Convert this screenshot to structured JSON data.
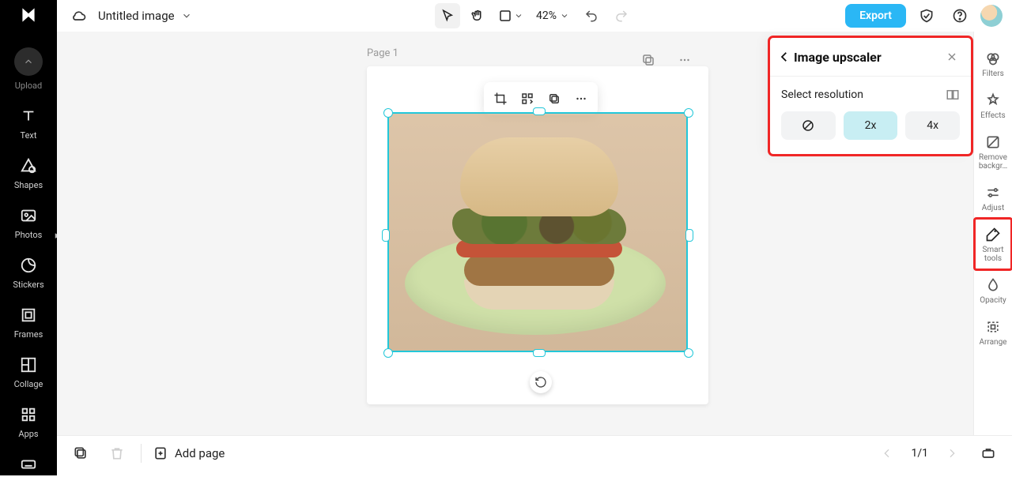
{
  "document": {
    "title": "Untitled image"
  },
  "header": {
    "zoom": "42%",
    "export_label": "Export"
  },
  "sidebar": {
    "items": [
      {
        "label": "Upload"
      },
      {
        "label": "Text"
      },
      {
        "label": "Shapes"
      },
      {
        "label": "Photos"
      },
      {
        "label": "Stickers"
      },
      {
        "label": "Frames"
      },
      {
        "label": "Collage"
      },
      {
        "label": "Apps"
      }
    ]
  },
  "right_panel": {
    "items": [
      {
        "label": "Filters"
      },
      {
        "label": "Effects"
      },
      {
        "label": "Remove backgr…"
      },
      {
        "label": "Adjust"
      },
      {
        "label": "Smart tools"
      },
      {
        "label": "Opacity"
      },
      {
        "label": "Arrange"
      }
    ]
  },
  "upscaler_panel": {
    "title": "Image upscaler",
    "select_label": "Select resolution",
    "options": {
      "none": "⦸",
      "two_x": "2x",
      "four_x": "4x"
    },
    "active": "two_x"
  },
  "canvas": {
    "page_label": "Page 1"
  },
  "footer": {
    "add_page_label": "Add page",
    "page_indicator": "1/1"
  }
}
